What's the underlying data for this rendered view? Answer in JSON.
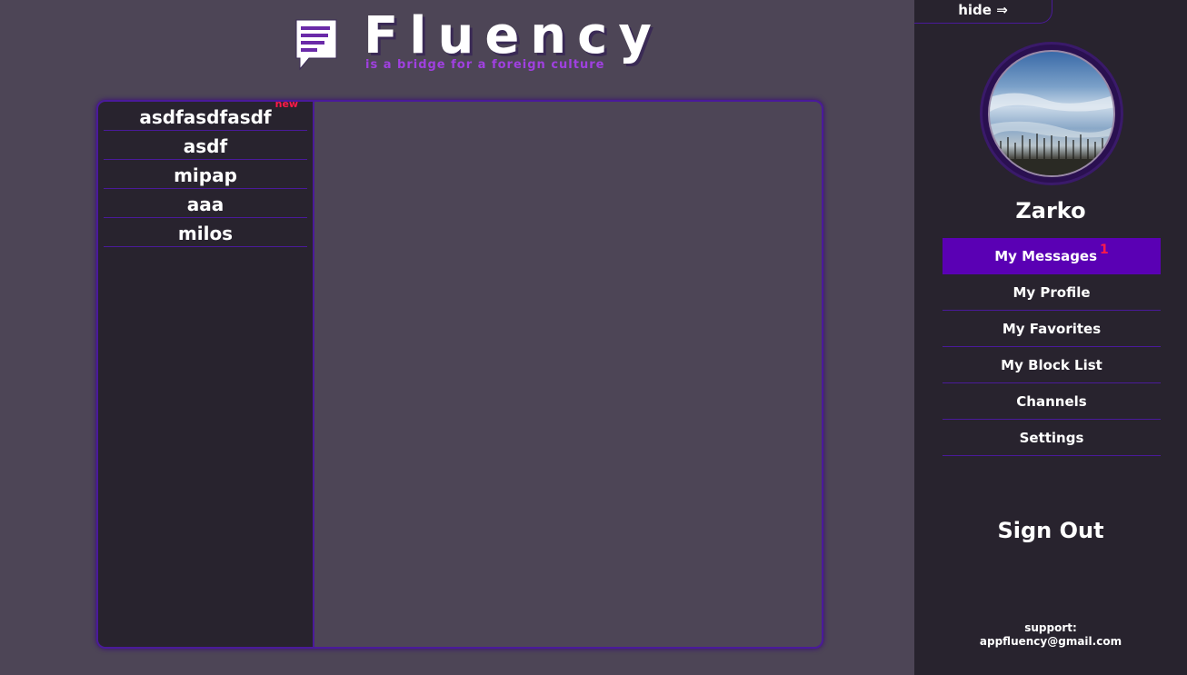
{
  "logo": {
    "title": "Fluency",
    "tagline": "is a bridge for a foreign culture",
    "icon": "speech-bubble-icon"
  },
  "contacts": [
    {
      "name": "asdfasdfasdf",
      "badge": "new"
    },
    {
      "name": "asdf",
      "badge": ""
    },
    {
      "name": "mipap",
      "badge": ""
    },
    {
      "name": "aaa",
      "badge": ""
    },
    {
      "name": "milos",
      "badge": ""
    }
  ],
  "sidebar": {
    "hide_label": "hide ⇒",
    "username": "Zarko",
    "menu": [
      {
        "label": "My Messages",
        "count": "1",
        "active": true
      },
      {
        "label": "My Profile",
        "count": "",
        "active": false
      },
      {
        "label": "My Favorites",
        "count": "",
        "active": false
      },
      {
        "label": "My Block List",
        "count": "",
        "active": false
      },
      {
        "label": "Channels",
        "count": "",
        "active": false
      },
      {
        "label": "Settings",
        "count": "",
        "active": false
      }
    ],
    "sign_out": "Sign Out",
    "support_label": "support:",
    "support_email": "appfluency@gmail.com"
  },
  "colors": {
    "background": "#4d4556",
    "panel": "#28232e",
    "accent": "#5a00b4",
    "border": "#4a1a9a",
    "tagline": "#a040e0",
    "badge": "#ff1a4a"
  }
}
